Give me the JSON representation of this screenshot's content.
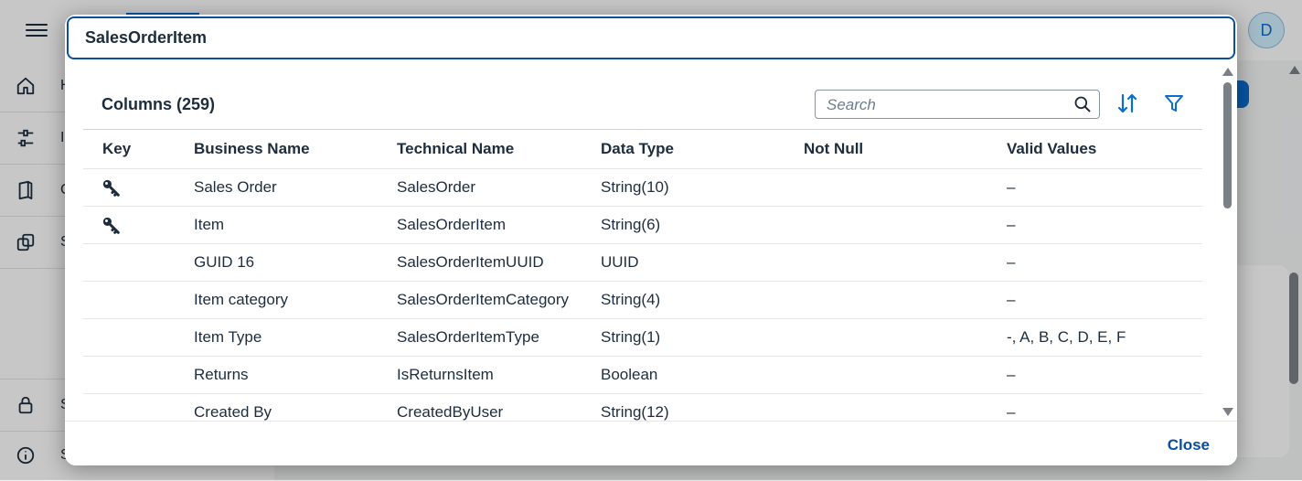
{
  "app": {
    "avatar_initial": "D",
    "nav_items": [
      {
        "icon": "home-icon",
        "label": "H"
      },
      {
        "icon": "sliders-icon",
        "label": "I"
      },
      {
        "icon": "book-icon",
        "label": "C"
      },
      {
        "icon": "copy-icon",
        "label": "S"
      },
      {
        "icon": "lock-icon",
        "label": "S"
      },
      {
        "icon": "info-icon",
        "label": "S"
      }
    ]
  },
  "dialog": {
    "title": "SalesOrderItem",
    "columns_title": "Columns (259)",
    "search_placeholder": "Search",
    "sort_icon": "sort-icon",
    "filter_icon": "filter-icon",
    "close_label": "Close",
    "headers": [
      "Key",
      "Business Name",
      "Technical Name",
      "Data Type",
      "Not Null",
      "Valid Values"
    ],
    "rows": [
      {
        "key": true,
        "business_name": "Sales Order",
        "technical_name": "SalesOrder",
        "data_type": "String(10)",
        "not_null": "",
        "valid_values": "–"
      },
      {
        "key": true,
        "business_name": "Item",
        "technical_name": "SalesOrderItem",
        "data_type": "String(6)",
        "not_null": "",
        "valid_values": "–"
      },
      {
        "key": false,
        "business_name": "GUID 16",
        "technical_name": "SalesOrderItemUUID",
        "data_type": "UUID",
        "not_null": "",
        "valid_values": "–"
      },
      {
        "key": false,
        "business_name": "Item category",
        "technical_name": "SalesOrderItemCategory",
        "data_type": "String(4)",
        "not_null": "",
        "valid_values": "–"
      },
      {
        "key": false,
        "business_name": "Item Type",
        "technical_name": "SalesOrderItemType",
        "data_type": "String(1)",
        "not_null": "",
        "valid_values": "-, A, B, C, D, E, F"
      },
      {
        "key": false,
        "business_name": "Returns",
        "technical_name": "IsReturnsItem",
        "data_type": "Boolean",
        "not_null": "",
        "valid_values": "–"
      },
      {
        "key": false,
        "business_name": "Created By",
        "technical_name": "CreatedByUser",
        "data_type": "String(12)",
        "not_null": "",
        "valid_values": "–"
      }
    ]
  },
  "colors": {
    "accent": "#0a6ed1",
    "header_border": "#0a4ea1",
    "text": "#1d2d3e"
  }
}
